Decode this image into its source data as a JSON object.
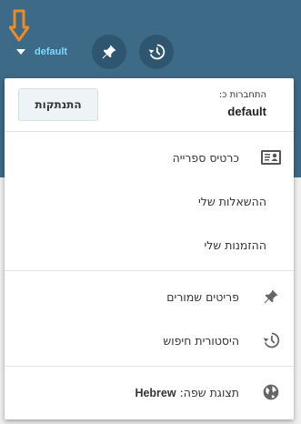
{
  "header": {
    "user_name": "default"
  },
  "menu": {
    "login_label": "התחברות כ:",
    "login_user": "default",
    "logout_label": "התנתקות",
    "account_items": [
      {
        "label": "כרטיס ספרייה",
        "icon": "library-card-icon"
      },
      {
        "label": "ההשאלות שלי"
      },
      {
        "label": "ההזמנות שלי"
      }
    ],
    "saved_items": [
      {
        "label": "פריטים שמורים",
        "icon": "pin-icon"
      },
      {
        "label": "היסטורית חיפוש",
        "icon": "history-icon"
      }
    ],
    "language_label": "תצוגת שפה:",
    "language_value": "Hebrew"
  },
  "colors": {
    "header_bg": "#3c6a87",
    "accent": "#7fd9ff",
    "arrow": "#f08a24"
  }
}
